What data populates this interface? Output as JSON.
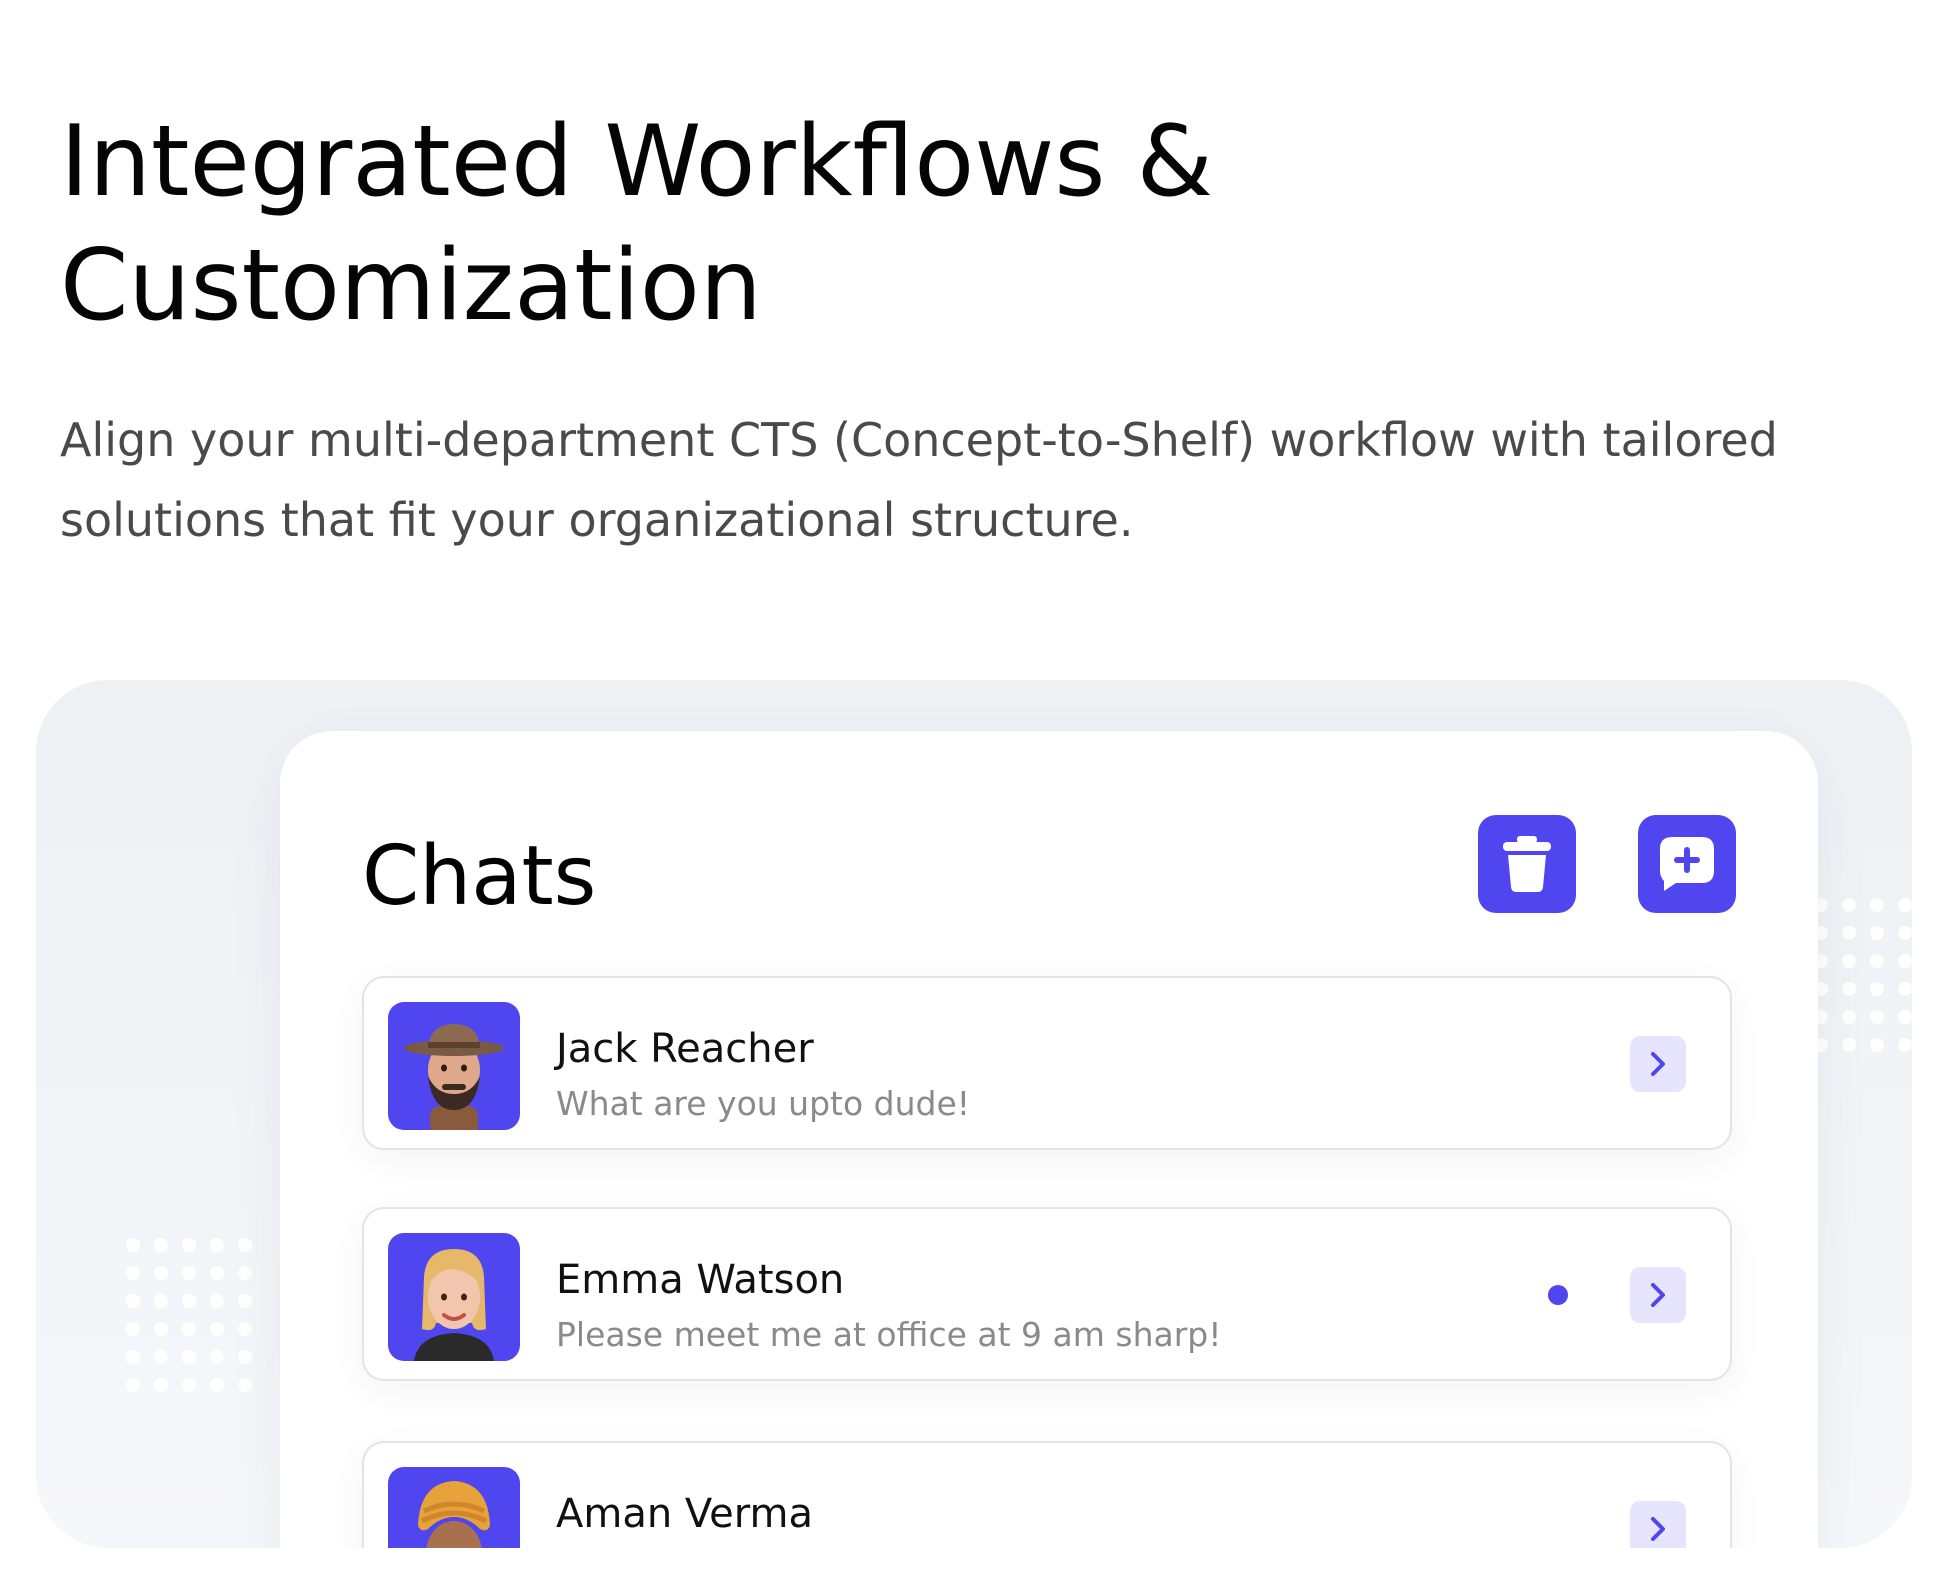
{
  "hero": {
    "title": "Integrated Workflows & Customization",
    "description": "Align your multi-department CTS (Concept-to-Shelf) workflow with tailored solutions that fit your organizational structure."
  },
  "chat_panel": {
    "title": "Chats",
    "actions": {
      "delete_icon": "trash-icon",
      "new_icon": "add-chat-icon"
    },
    "conversations": [
      {
        "name": "Jack Reacher",
        "preview": "What are you upto dude!",
        "unread": false,
        "avatar": "bearded-man-with-hat"
      },
      {
        "name": "Emma Watson",
        "preview": "Please meet me at office at 9 am sharp!",
        "unread": true,
        "avatar": "blonde-woman"
      },
      {
        "name": "Aman Verma",
        "preview": "",
        "unread": false,
        "avatar": "man-with-turban"
      }
    ]
  },
  "colors": {
    "accent": "#4f46f0",
    "accent_soft": "#e6e5fd",
    "showcase_bg": "#eef0f4",
    "body_text": "#4a4a4a",
    "muted_text": "#8a8a8a"
  }
}
